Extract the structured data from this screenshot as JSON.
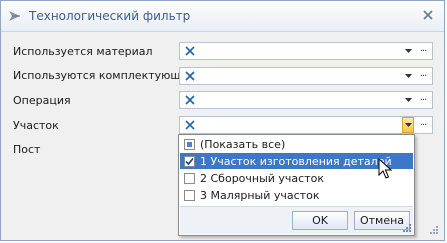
{
  "window": {
    "title": "Технологический фильтр"
  },
  "fields": [
    {
      "label": "Используется материал"
    },
    {
      "label": "Используются комплектующие"
    },
    {
      "label": "Операция"
    },
    {
      "label": "Участок"
    },
    {
      "label": "Пост"
    }
  ],
  "combo": {
    "clear_symbol": "✕",
    "ellipsis": "···"
  },
  "dropdown": {
    "options": [
      {
        "label": "(Показать все)",
        "state": "partial"
      },
      {
        "label": "1 Участок изготовления деталей",
        "state": "checked"
      },
      {
        "label": "2 Сборочный участок",
        "state": "unchecked"
      },
      {
        "label": "3 Малярный участок",
        "state": "unchecked"
      }
    ],
    "ok_label": "OK",
    "cancel_label": "Отмена"
  },
  "colors": {
    "selection": "#3e77c6",
    "accent": "#f6c553",
    "title_text": "#3d5d8b"
  }
}
